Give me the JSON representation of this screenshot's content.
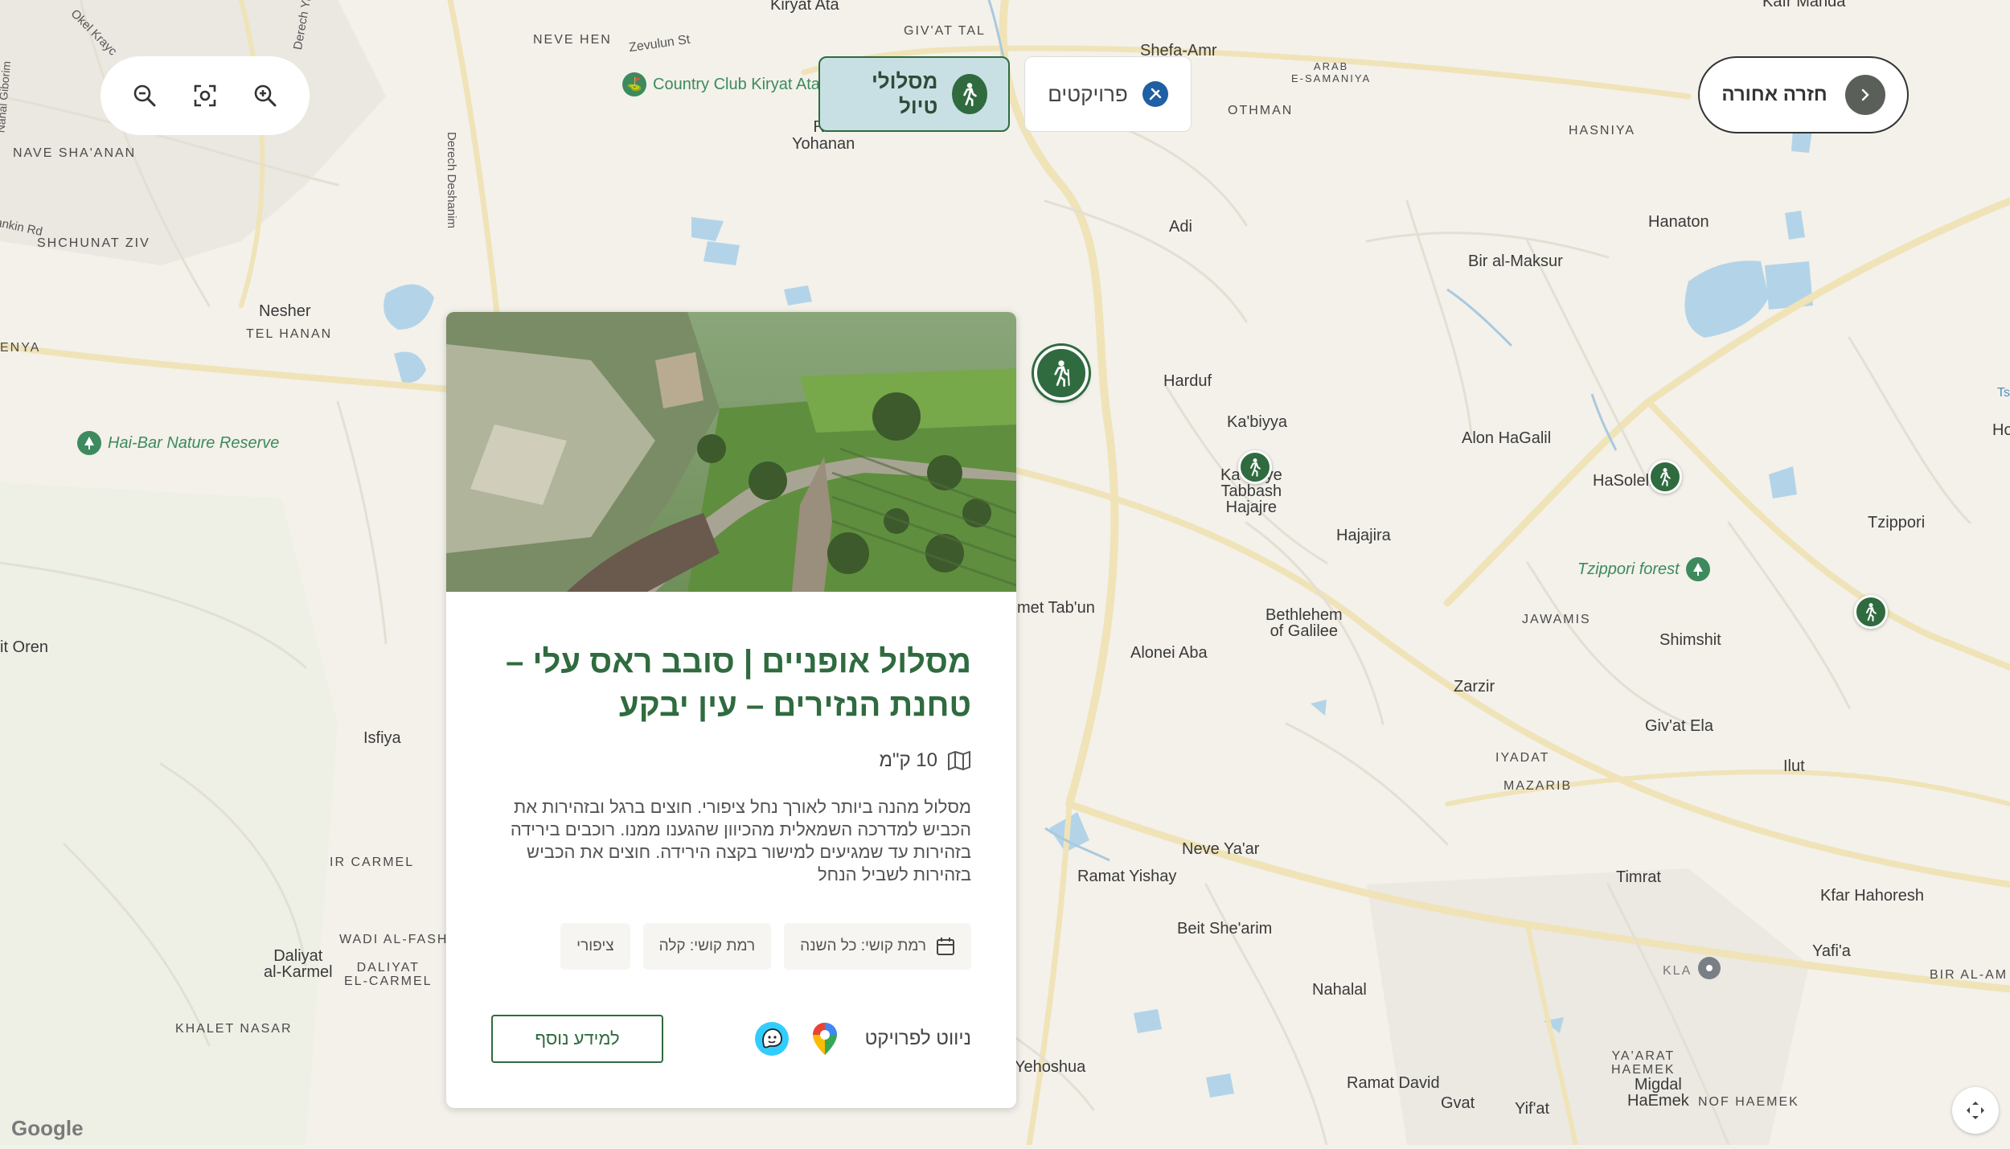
{
  "map": {
    "places": [
      {
        "name": "Kiryat Ata",
        "style": "normal"
      },
      {
        "name": "GIV'AT TAL",
        "style": "caps"
      },
      {
        "name": "Shefa-Amr",
        "style": "normal"
      },
      {
        "name": "Kafr Manda",
        "style": "normal"
      },
      {
        "name": "NEVE HEN",
        "style": "caps"
      },
      {
        "name": "Zevulun St",
        "style": "road"
      },
      {
        "name": "ARAB\nE-SAMANIYA",
        "style": "caps"
      },
      {
        "name": "OTHMAN",
        "style": "caps"
      },
      {
        "name": "HASNIYA",
        "style": "caps"
      },
      {
        "name": "Ra\nYohanan",
        "style": "normal"
      },
      {
        "name": "NAVE SHA'ANAN",
        "style": "caps"
      },
      {
        "name": "SHCHUNAT ZIV",
        "style": "caps"
      },
      {
        "name": "Adi",
        "style": "normal"
      },
      {
        "name": "Hanaton",
        "style": "normal"
      },
      {
        "name": "Bir al-Maksur",
        "style": "normal"
      },
      {
        "name": "Nesher",
        "style": "normal"
      },
      {
        "name": "TEL HANAN",
        "style": "caps"
      },
      {
        "name": "Harduf",
        "style": "normal"
      },
      {
        "name": "Ka'biyya",
        "style": "normal"
      },
      {
        "name": "Alon HaGalil",
        "style": "normal"
      },
      {
        "name": "HaSolelim",
        "style": "normal"
      },
      {
        "name": "Ka biyye\nTabbash\nHajajre",
        "style": "normal"
      },
      {
        "name": "Hajajira",
        "style": "normal"
      },
      {
        "name": "Tzippori",
        "style": "normal"
      },
      {
        "name": "Bethlehem\nof Galilee",
        "style": "normal"
      },
      {
        "name": "JAWAMIS",
        "style": "caps"
      },
      {
        "name": "Shimshit",
        "style": "normal"
      },
      {
        "name": "Alonei Aba",
        "style": "normal"
      },
      {
        "name": "Zarzir",
        "style": "normal"
      },
      {
        "name": "Giv'at Ela",
        "style": "normal"
      },
      {
        "name": "IYADAT",
        "style": "caps"
      },
      {
        "name": "MAZARIB",
        "style": "caps"
      },
      {
        "name": "Ilut",
        "style": "normal"
      },
      {
        "name": "Isfiya",
        "style": "normal"
      },
      {
        "name": "IR CARMEL",
        "style": "caps"
      },
      {
        "name": "Neve Ya'ar",
        "style": "normal"
      },
      {
        "name": "Ramat Yishay",
        "style": "normal"
      },
      {
        "name": "Timrat",
        "style": "normal"
      },
      {
        "name": "Kfar Hahoresh",
        "style": "normal"
      },
      {
        "name": "Beit She'arim",
        "style": "normal"
      },
      {
        "name": "WADI AL-FASH",
        "style": "caps"
      },
      {
        "name": "Daliyat\nal-Karmel",
        "style": "normal"
      },
      {
        "name": "DALIYAT\nEL-CARMEL",
        "style": "caps"
      },
      {
        "name": "Yafi'a",
        "style": "normal"
      },
      {
        "name": "BIR AL-AM",
        "style": "caps"
      },
      {
        "name": "KLA",
        "style": "caps"
      },
      {
        "name": "Nahalal",
        "style": "normal"
      },
      {
        "name": "KHALET NASAR",
        "style": "caps"
      },
      {
        "name": "Ramat David",
        "style": "normal"
      },
      {
        "name": "Gvat",
        "style": "normal"
      },
      {
        "name": "Yif'at",
        "style": "normal"
      },
      {
        "name": "YA'ARAT\nHAEMEK",
        "style": "caps"
      },
      {
        "name": "Migdal\nHaEmek",
        "style": "normal"
      },
      {
        "name": "NOF HAEMEK",
        "style": "caps"
      },
      {
        "name": "it Oren",
        "style": "normal"
      },
      {
        "name": "ENYA",
        "style": "caps"
      },
      {
        "name": "met Tab'un",
        "style": "normal"
      },
      {
        "name": "Yehoshua",
        "style": "normal"
      },
      {
        "name": "Derech Deshanim",
        "style": "road"
      },
      {
        "name": "Okel Krayc",
        "style": "road"
      },
      {
        "name": "Derech Yig",
        "style": "road"
      },
      {
        "name": "Nahal Giborim",
        "style": "road"
      },
      {
        "name": "ankin Rd",
        "style": "road"
      },
      {
        "name": "Ho",
        "style": "normal"
      },
      {
        "name": "Ts",
        "style": "road"
      }
    ],
    "pois": [
      {
        "name": "Country Club Kiryat Ata",
        "icon": "golf-icon"
      },
      {
        "name": "Hai-Bar Nature Reserve",
        "icon": "tree-icon"
      },
      {
        "name": "Tzippori forest",
        "icon": "tree-icon"
      }
    ]
  },
  "zoom": {
    "zoom_out": "zoom-out-icon",
    "fit": "fit-bounds-icon",
    "zoom_in": "zoom-in-icon"
  },
  "filters": {
    "trails_label": "מסלולי טיול",
    "projects_label": "פרויקטים"
  },
  "back_button": {
    "label": "חזרה אחורה"
  },
  "card": {
    "title": "מסלול אופניים | סובב ראס עלי – טחנת הנזירים – עין יבקע",
    "distance": "10 ק\"מ",
    "description": "מסלול מהנה ביותר לאורך נחל ציפורי. חוצים ברגל ובזהירות את הכביש למדרכה השמאלית מהכיוון שהגענו ממנו. רוכבים בירידה בזהירות עד שמגיעים למישור בקצה הירידה. חוצים את הכביש בזהירות לשביל הנחל",
    "tags": [
      "רמת קושי: כל השנה",
      "רמת קושי: קלה",
      "ציפורי"
    ],
    "navigate_label": "ניווט לפרויקט",
    "more_info_label": "למידע נוסף"
  },
  "attribution": "Google",
  "colors": {
    "brand_green": "#2f6b3f",
    "active_filter_bg": "#c8e0e3",
    "projects_icon": "#1f5fa3",
    "map_bg": "#f3f1ea",
    "water": "#b3d4e8"
  }
}
